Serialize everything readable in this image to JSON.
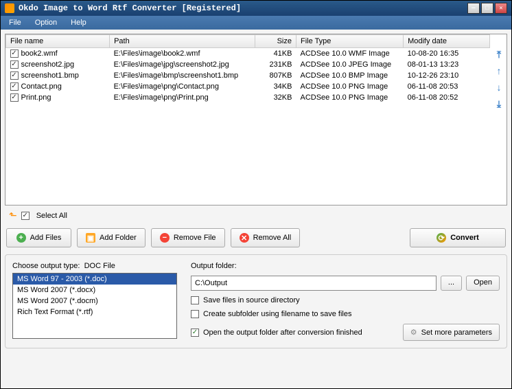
{
  "title": "Okdo Image to Word Rtf Converter [Registered]",
  "menu": {
    "file": "File",
    "option": "Option",
    "help": "Help"
  },
  "table": {
    "headers": {
      "name": "File name",
      "path": "Path",
      "size": "Size",
      "type": "File Type",
      "date": "Modify date"
    },
    "rows": [
      {
        "name": "book2.wmf",
        "path": "E:\\Files\\image\\book2.wmf",
        "size": "41KB",
        "type": "ACDSee 10.0 WMF Image",
        "date": "10-08-20 16:35"
      },
      {
        "name": "screenshot2.jpg",
        "path": "E:\\Files\\image\\jpg\\screenshot2.jpg",
        "size": "231KB",
        "type": "ACDSee 10.0 JPEG Image",
        "date": "08-01-13 13:23"
      },
      {
        "name": "screenshot1.bmp",
        "path": "E:\\Files\\image\\bmp\\screenshot1.bmp",
        "size": "807KB",
        "type": "ACDSee 10.0 BMP Image",
        "date": "10-12-26 23:10"
      },
      {
        "name": "Contact.png",
        "path": "E:\\Files\\image\\png\\Contact.png",
        "size": "34KB",
        "type": "ACDSee 10.0 PNG Image",
        "date": "06-11-08 20:53"
      },
      {
        "name": "Print.png",
        "path": "E:\\Files\\image\\png\\Print.png",
        "size": "32KB",
        "type": "ACDSee 10.0 PNG Image",
        "date": "06-11-08 20:52"
      }
    ]
  },
  "selectAll": "Select All",
  "buttons": {
    "addFiles": "Add Files",
    "addFolder": "Add Folder",
    "removeFile": "Remove File",
    "removeAll": "Remove All",
    "convert": "Convert"
  },
  "outputType": {
    "label": "Choose output type:",
    "current": "DOC File",
    "items": [
      "MS Word 97 - 2003 (*.doc)",
      "MS Word 2007 (*.docx)",
      "MS Word 2007 (*.docm)",
      "Rich Text Format (*.rtf)"
    ]
  },
  "outputFolder": {
    "label": "Output folder:",
    "value": "C:\\Output",
    "browse": "...",
    "open": "Open"
  },
  "options": {
    "saveSource": "Save files in source directory",
    "createSubfolder": "Create subfolder using filename to save files",
    "openAfter": "Open the output folder after conversion finished"
  },
  "params": "Set more parameters"
}
